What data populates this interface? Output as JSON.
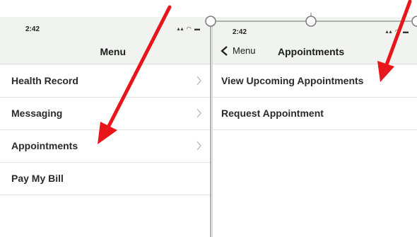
{
  "left_screen": {
    "status_time": "2:42",
    "status_icons": "▴▴ ◠ ▬",
    "title": "Menu",
    "items": [
      {
        "label": "Health Record"
      },
      {
        "label": "Messaging"
      },
      {
        "label": "Appointments"
      },
      {
        "label": "Pay My Bill"
      }
    ]
  },
  "right_screen": {
    "status_time": "2:42",
    "status_icons": "▴▴ ◠ ▬",
    "back_label": "Menu",
    "title": "Appointments",
    "items": [
      {
        "label": "View Upcoming Appointments"
      },
      {
        "label": "Request Appointment"
      }
    ]
  },
  "colors": {
    "arrow": "#e8161b",
    "header_bg": "#f1f3f1",
    "text": "#2a2a2a"
  }
}
